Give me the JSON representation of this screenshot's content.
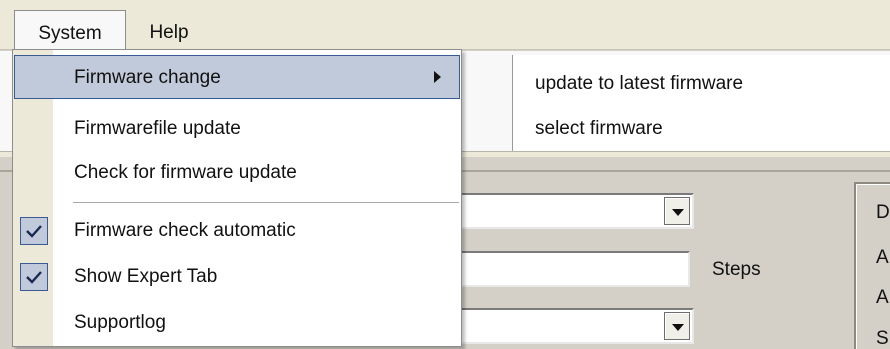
{
  "menubar": {
    "items": [
      {
        "label": "System"
      },
      {
        "label": "Help"
      }
    ]
  },
  "system_menu": {
    "items": [
      {
        "label": "Firmware change",
        "has_submenu": true,
        "highlighted": true
      },
      {
        "label": "Firmwarefile update"
      },
      {
        "label": "Check for firmware update"
      },
      {
        "label": "Firmware check automatic",
        "checked": true
      },
      {
        "label": "Show Expert Tab",
        "checked": true
      },
      {
        "label": "Supportlog"
      }
    ]
  },
  "firmware_submenu": {
    "items": [
      {
        "label": "update to latest firmware"
      },
      {
        "label": "select firmware"
      }
    ]
  },
  "background": {
    "steps_label": "Steps",
    "side_group_letters": [
      "D",
      "A",
      "A",
      "S"
    ]
  },
  "colors": {
    "highlight": "#c1cadb",
    "highlight_border": "#3a5a93",
    "menubar": "#ece9d8",
    "panel": "#d4d0c8"
  }
}
